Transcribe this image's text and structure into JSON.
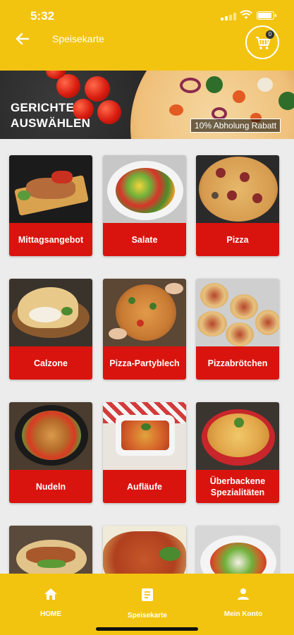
{
  "status": {
    "time": "5:32"
  },
  "header": {
    "title": "Speisekarte",
    "cart_count": "0"
  },
  "banner": {
    "headline_line1": "GERICHTE",
    "headline_line2": "AUSWÄHLEN",
    "promo": "10% Abholung Rabatt"
  },
  "categories": [
    {
      "label": "Mittagsangebot"
    },
    {
      "label": "Salate"
    },
    {
      "label": "Pizza"
    },
    {
      "label": "Calzone"
    },
    {
      "label": "Pizza-Partyblech"
    },
    {
      "label": "Pizzabrötchen"
    },
    {
      "label": "Nudeln"
    },
    {
      "label": "Aufläufe"
    },
    {
      "label": "Überbackene Spezialitäten"
    }
  ],
  "bottom_nav": [
    {
      "label": "HOME",
      "icon": "home-icon"
    },
    {
      "label": "Speisekarte",
      "icon": "menu-card-icon"
    },
    {
      "label": "Mein Konto",
      "icon": "person-icon"
    }
  ],
  "colors": {
    "brand_yellow": "#f2c40f",
    "label_red": "#d9140e",
    "background": "#ececec"
  }
}
